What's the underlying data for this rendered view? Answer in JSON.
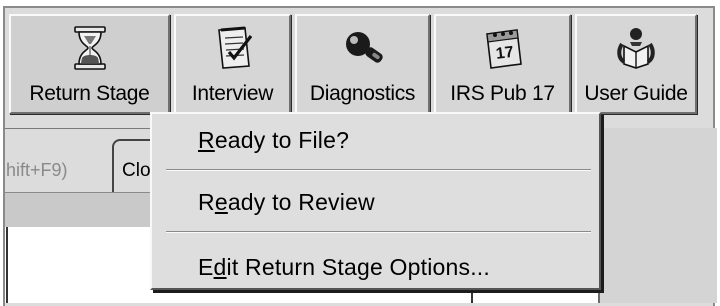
{
  "toolbar": {
    "buttons": [
      {
        "label": "Return Stage",
        "icon": "hourglass-icon"
      },
      {
        "label": "Interview",
        "icon": "checklist-notepad-icon"
      },
      {
        "label": "Diagnostics",
        "icon": "magnifier-icon"
      },
      {
        "label": "IRS Pub 17",
        "icon": "calendar-17-icon"
      },
      {
        "label": "User Guide",
        "icon": "reading-person-icon"
      }
    ]
  },
  "tabs": {
    "partial_left": "hift+F9)",
    "partial_tab": "Clo"
  },
  "menu": {
    "items": [
      {
        "pre": "",
        "mnemonic": "R",
        "post": "eady to File?"
      },
      {
        "pre": "R",
        "mnemonic": "e",
        "post": "ady to Review"
      },
      {
        "pre": "E",
        "mnemonic": "d",
        "post": "it Return Stage Options..."
      }
    ]
  }
}
